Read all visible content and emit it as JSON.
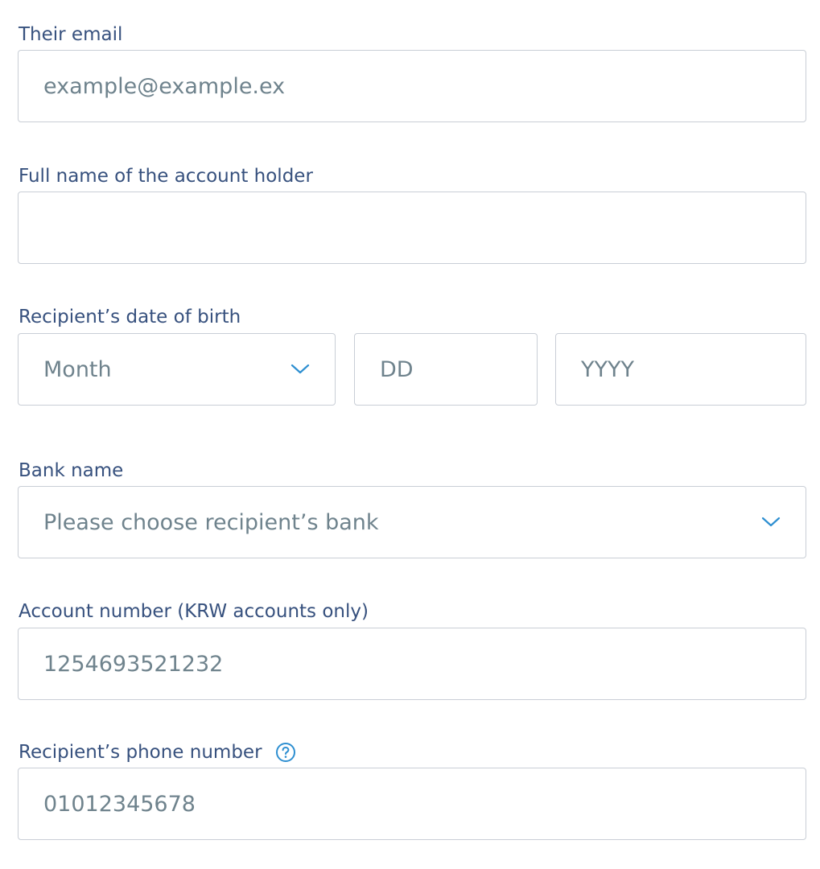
{
  "form": {
    "email": {
      "label": "Their email",
      "placeholder": "example@example.ex",
      "value": ""
    },
    "full_name": {
      "label": "Full name of the account holder",
      "placeholder": "",
      "value": ""
    },
    "dob": {
      "label": "Recipient’s date of birth",
      "month": {
        "selected": "Month"
      },
      "day": {
        "placeholder": "DD",
        "value": ""
      },
      "year": {
        "placeholder": "YYYY",
        "value": ""
      }
    },
    "bank": {
      "label": "Bank name",
      "selected": "Please choose recipient’s bank"
    },
    "account_number": {
      "label": "Account number (KRW accounts only)",
      "placeholder": "1254693521232",
      "value": ""
    },
    "phone": {
      "label": "Recipient’s phone number",
      "placeholder": "01012345678",
      "value": ""
    }
  },
  "icons": {
    "chevron": "chevron-down-icon",
    "help": "question-circle-icon"
  },
  "colors": {
    "label": "#37517e",
    "placeholder": "#6f838d",
    "border": "#c9ced6",
    "accent": "#2e8fd1"
  }
}
